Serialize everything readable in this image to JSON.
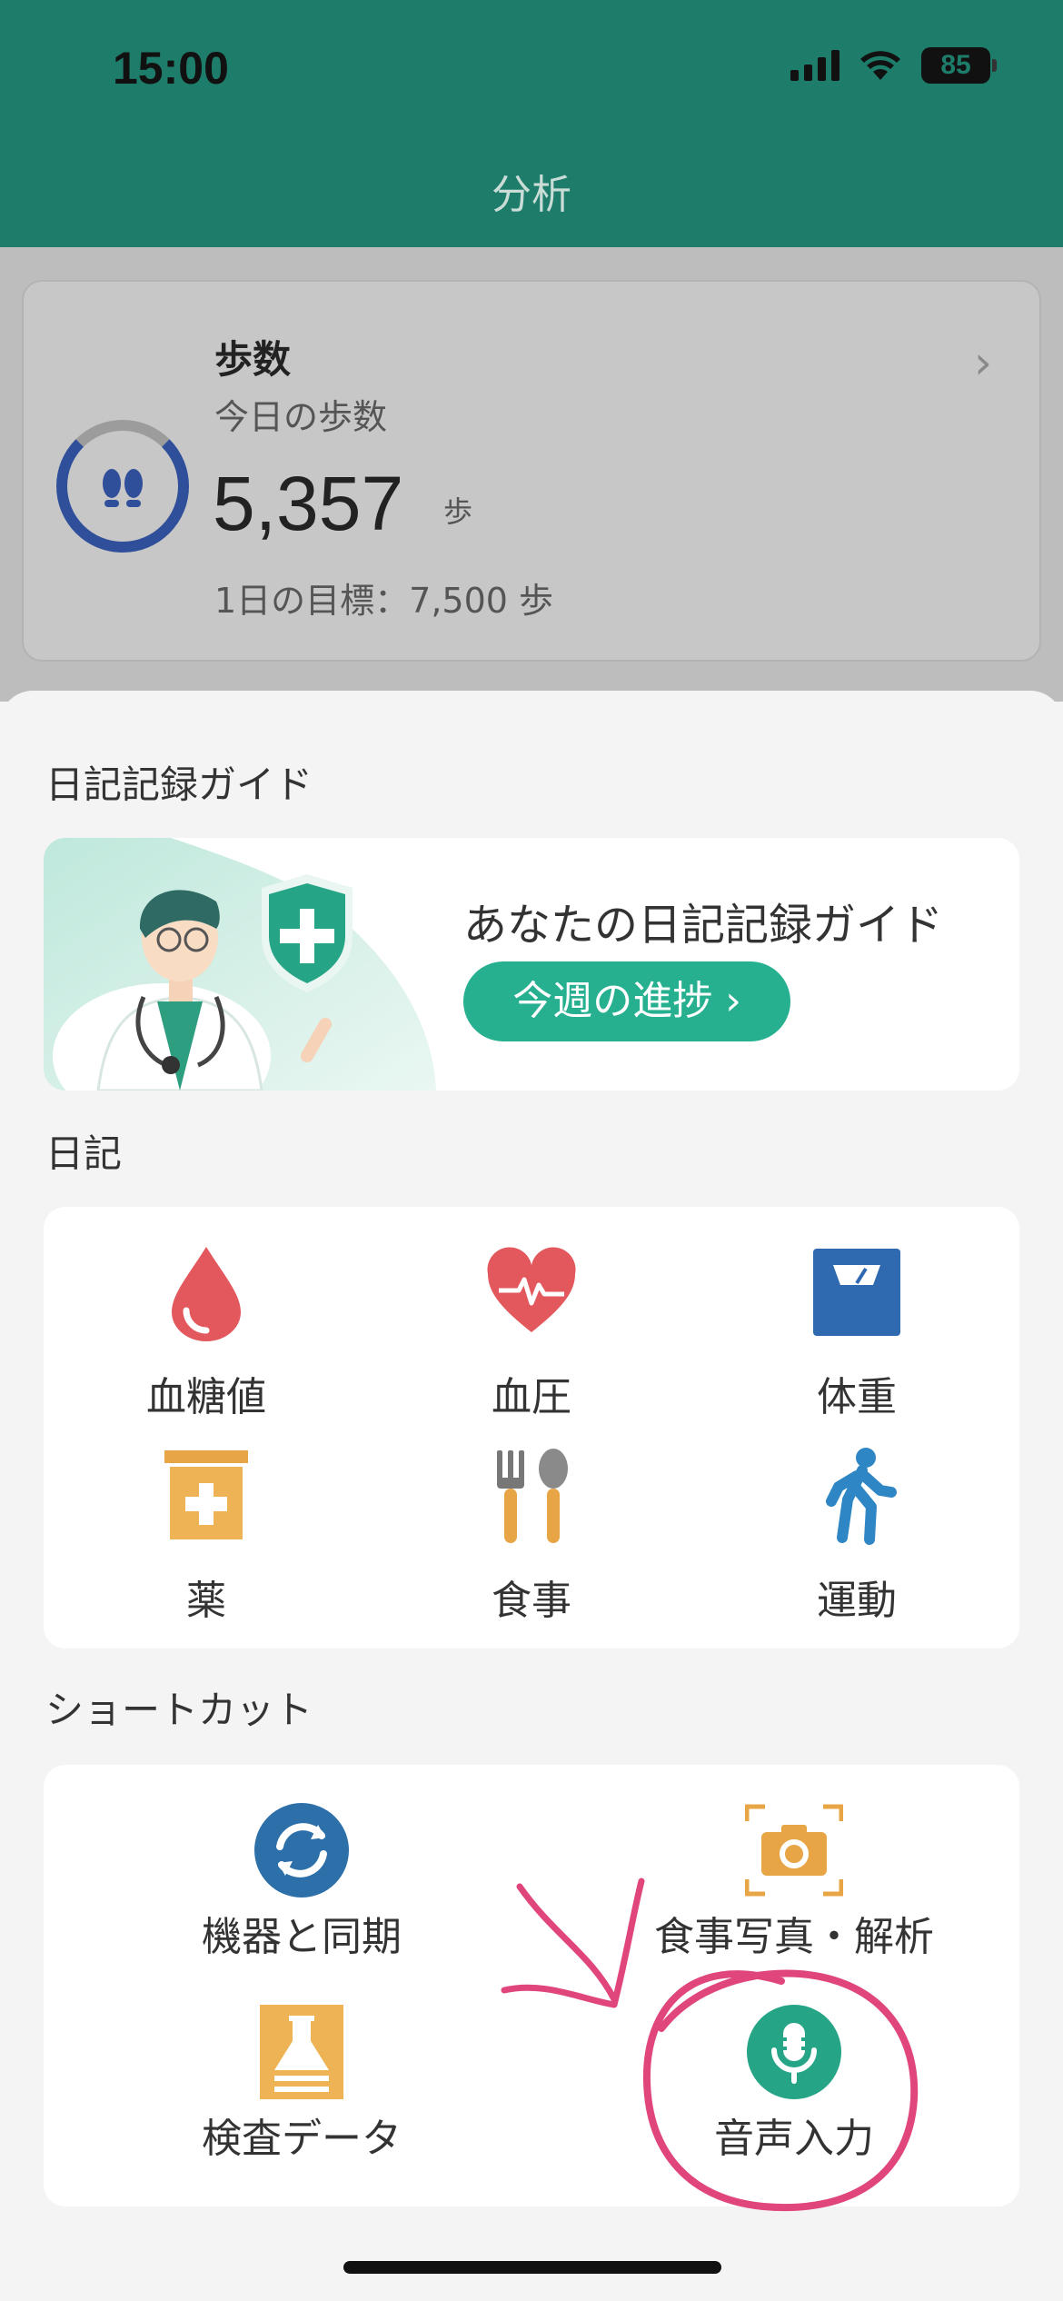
{
  "status_bar": {
    "time": "15:00",
    "battery": "85"
  },
  "header": {
    "title": "分析"
  },
  "steps_card": {
    "title": "歩数",
    "subtitle": "今日の歩数",
    "value": "5,357",
    "unit": "歩",
    "goal": "1日の目標：7,500 歩",
    "progress_fraction": 0.71
  },
  "guide_section": {
    "label": "日記記録ガイド",
    "card_title": "あなたの日記記録ガイド",
    "button_label": "今週の進捗 ›"
  },
  "diary_section": {
    "label": "日記",
    "items": [
      {
        "label": "血糖値",
        "icon": "blood-drop-icon"
      },
      {
        "label": "血圧",
        "icon": "heart-pulse-icon"
      },
      {
        "label": "体重",
        "icon": "scale-icon"
      },
      {
        "label": "薬",
        "icon": "medicine-box-icon"
      },
      {
        "label": "食事",
        "icon": "fork-spoon-icon"
      },
      {
        "label": "運動",
        "icon": "walking-person-icon"
      }
    ]
  },
  "shortcut_section": {
    "label": "ショートカット",
    "items": [
      {
        "label": "機器と同期",
        "icon": "sync-icon"
      },
      {
        "label": "食事写真・解析",
        "icon": "camera-icon"
      },
      {
        "label": "検査データ",
        "icon": "flask-icon"
      },
      {
        "label": "音声入力",
        "icon": "microphone-icon"
      }
    ]
  },
  "colors": {
    "header": "#1e7d6a",
    "accent_button": "#26b08f",
    "annotation": "#e0467c"
  }
}
